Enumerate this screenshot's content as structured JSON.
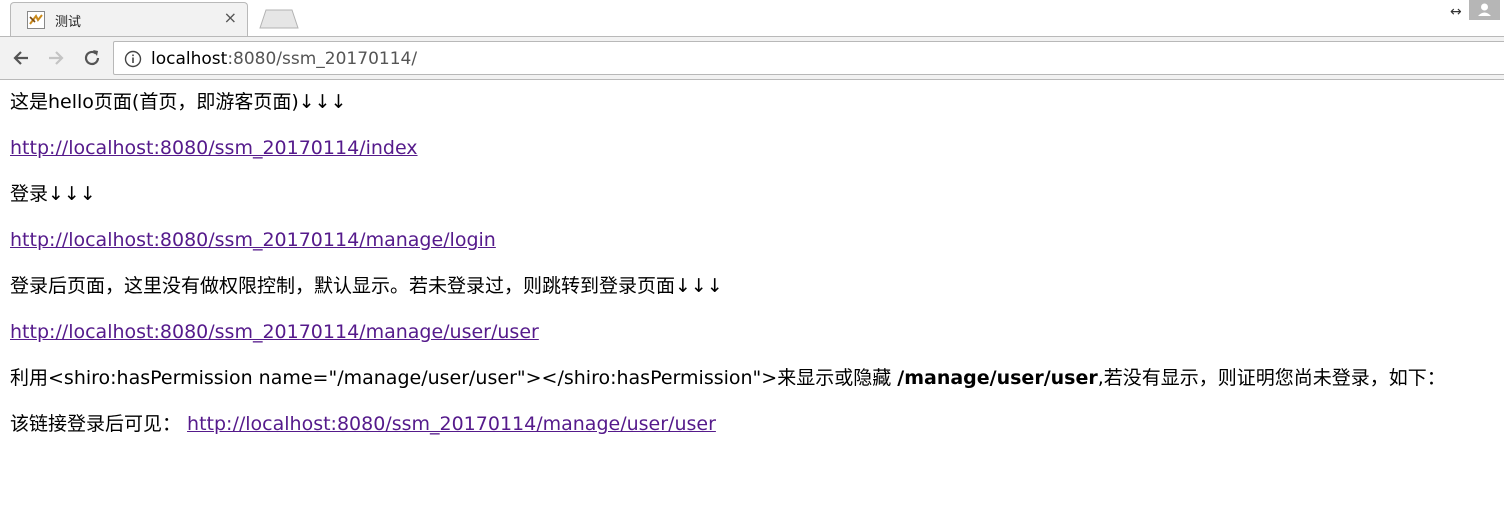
{
  "browser": {
    "tab_title": "测试",
    "tab_close": "×",
    "resize_glyph": "↔",
    "url_host": "localhost",
    "url_rest": ":8080/ssm_20170114/"
  },
  "content": {
    "line1": "这是hello页面(首页，即游客页面)↓↓↓",
    "link1": "http://localhost:8080/ssm_20170114/index",
    "line2": "登录↓↓↓",
    "link2": "http://localhost:8080/ssm_20170114/manage/login",
    "line3": "登录后页面，这里没有做权限控制，默认显示。若未登录过，则跳转到登录页面↓↓↓",
    "link3": "http://localhost:8080/ssm_20170114/manage/user/user",
    "line4_prefix": "利用<shiro:hasPermission name=\"/manage/user/user\"></shiro:hasPermission\">来显示或隐藏 ",
    "line4_bold": "/manage/user/user",
    "line4_suffix": ",若没有显示，则证明您尚未登录，如下：",
    "line5_prefix": "该链接登录后可见： ",
    "link5": "http://localhost:8080/ssm_20170114/manage/user/user"
  },
  "colors": {
    "visited_link": "#551a8b",
    "chrome_bg": "#f2f2f2"
  }
}
